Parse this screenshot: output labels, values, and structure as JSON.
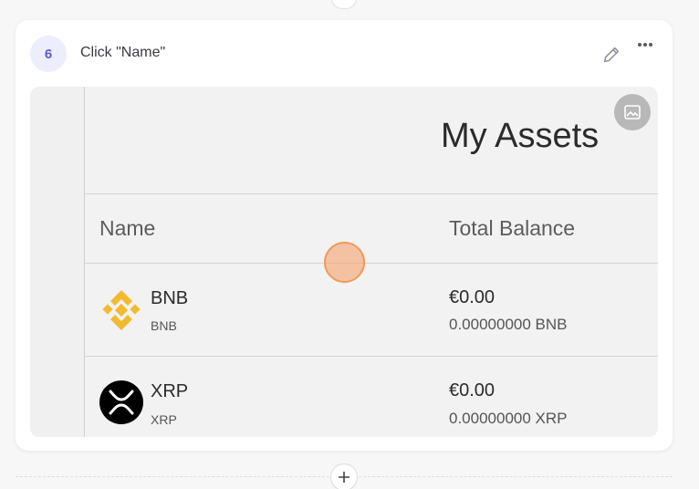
{
  "step": {
    "number": "6",
    "instruction": "Click \"Name\""
  },
  "screenshot": {
    "title": "My Assets",
    "columns": {
      "name": "Name",
      "balance": "Total Balance"
    },
    "assets": [
      {
        "name": "BNB",
        "symbol": "BNB",
        "fiat": "€0.00",
        "crypto": "0.00000000 BNB",
        "icon": "bnb-icon",
        "color": "#f3ba2f"
      },
      {
        "name": "XRP",
        "symbol": "XRP",
        "fiat": "€0.00",
        "crypto": "0.00000000 XRP",
        "icon": "xrp-icon",
        "color": "#000000"
      }
    ]
  },
  "colors": {
    "accent": "#5b5bd6",
    "click_marker": "#f29a59"
  },
  "icons": [
    "pencil-icon",
    "more-horizontal-icon",
    "image-edit-icon",
    "plus-icon"
  ]
}
